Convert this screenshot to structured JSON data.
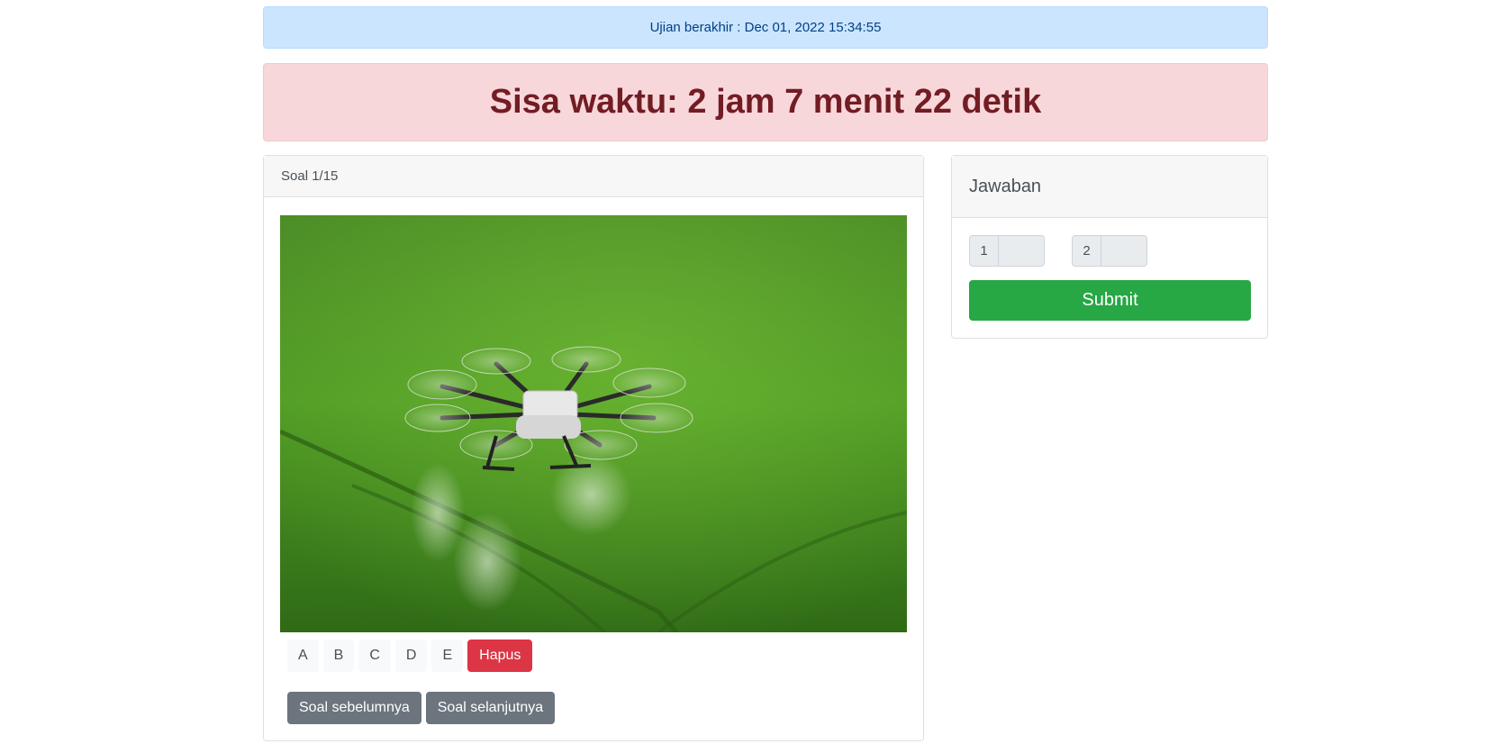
{
  "exam_end": {
    "text": "Ujian berakhir : Dec 01, 2022 15:34:55"
  },
  "timer": {
    "text": "Sisa waktu: 2 jam 7 menit 22 detik"
  },
  "question": {
    "header": "Soal 1/15",
    "image_description_icon": "drone-over-rice-field-photo",
    "options": [
      "A",
      "B",
      "C",
      "D",
      "E"
    ],
    "clear_label": "Hapus",
    "prev_label": "Soal sebelumnya",
    "next_label": "Soal selanjutnya"
  },
  "answers": {
    "header": "Jawaban",
    "items": [
      {
        "number": "1",
        "value": ""
      },
      {
        "number": "2",
        "value": ""
      }
    ],
    "submit_label": "Submit"
  },
  "colors": {
    "info_bg": "#cce5ff",
    "danger_bg": "#f8d7da",
    "danger_text": "#721c24",
    "success": "#28a745",
    "secondary": "#6c757d",
    "danger_btn": "#dc3545"
  }
}
